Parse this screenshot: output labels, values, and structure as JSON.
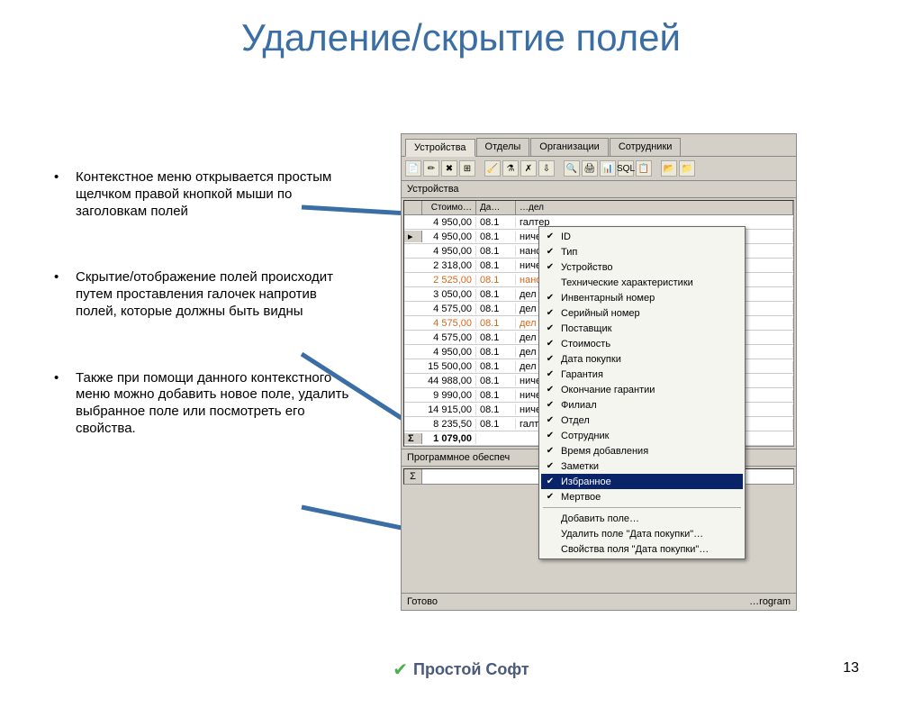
{
  "title": "Удаление/скрытие полей",
  "bullets": [
    "Контекстное меню открывается простым щелчком правой кнопкой мыши по заголовкам полей",
    "Скрытие/отображение полей происходит путем проставления галочек напротив полей, которые должны быть видны",
    "Также при помощи данного контекстного меню можно добавить новое поле, удалить выбранное поле или посмотреть его свойства."
  ],
  "page_number": "13",
  "footer_brand": "Простой Софт",
  "app": {
    "tabs": [
      "Устройства",
      "Отделы",
      "Организации",
      "Сотрудники"
    ],
    "active_tab": 0,
    "section1": "Устройства",
    "columns": [
      "Стоимо…",
      "Да…",
      "",
      "…дел"
    ],
    "rows": [
      {
        "c1": "4 950,00",
        "c2": "08.1",
        "c3": "галтер",
        "orange": false,
        "sel": false
      },
      {
        "c1": "4 950,00",
        "c2": "08.1",
        "c3": "ническ",
        "orange": false,
        "sel": true
      },
      {
        "c1": "4 950,00",
        "c2": "08.1",
        "c3": "нансов",
        "orange": false,
        "sel": false
      },
      {
        "c1": "2 318,00",
        "c2": "08.1",
        "c3": "ническ",
        "orange": false,
        "sel": false
      },
      {
        "c1": "2 525,00",
        "c2": "08.1",
        "c3": "нансов",
        "orange": true,
        "sel": false
      },
      {
        "c1": "3 050,00",
        "c2": "08.1",
        "c3": "дел раз",
        "orange": false,
        "sel": false
      },
      {
        "c1": "4 575,00",
        "c2": "08.1",
        "c3": "дел раз",
        "orange": false,
        "sel": false
      },
      {
        "c1": "4 575,00",
        "c2": "08.1",
        "c3": "дел раз",
        "orange": true,
        "sel": false
      },
      {
        "c1": "4 575,00",
        "c2": "08.1",
        "c3": "дел раз",
        "orange": false,
        "sel": false
      },
      {
        "c1": "4 950,00",
        "c2": "08.1",
        "c3": "дел раз",
        "orange": false,
        "sel": false
      },
      {
        "c1": "15 500,00",
        "c2": "08.1",
        "c3": "дел раз",
        "orange": false,
        "sel": false
      },
      {
        "c1": "44 988,00",
        "c2": "08.1",
        "c3": "ническ",
        "orange": false,
        "sel": false
      },
      {
        "c1": "9 990,00",
        "c2": "08.1",
        "c3": "ническ",
        "orange": false,
        "sel": false
      },
      {
        "c1": "14 915,00",
        "c2": "08.1",
        "c3": "ническ",
        "orange": false,
        "sel": false
      },
      {
        "c1": "8 235,50",
        "c2": "08.1",
        "c3": "галтер",
        "orange": false,
        "sel": false
      }
    ],
    "sum": "1 079,00",
    "section2": "Программное обеспеч",
    "status_left": "Готово",
    "status_right": "…rogram"
  },
  "context_menu": {
    "items": [
      {
        "label": "ID",
        "check": true
      },
      {
        "label": "Тип",
        "check": true
      },
      {
        "label": "Устройство",
        "check": true
      },
      {
        "label": "Технические характеристики",
        "check": false
      },
      {
        "label": "Инвентарный номер",
        "check": true
      },
      {
        "label": "Серийный номер",
        "check": true
      },
      {
        "label": "Поставщик",
        "check": true
      },
      {
        "label": "Стоимость",
        "check": true
      },
      {
        "label": "Дата покупки",
        "check": true
      },
      {
        "label": "Гарантия",
        "check": true
      },
      {
        "label": "Окончание гарантии",
        "check": true
      },
      {
        "label": "Филиал",
        "check": true
      },
      {
        "label": "Отдел",
        "check": true
      },
      {
        "label": "Сотрудник",
        "check": true
      },
      {
        "label": "Время добавления",
        "check": true
      },
      {
        "label": "Заметки",
        "check": true
      },
      {
        "label": "Избранное",
        "check": true,
        "selected": true
      },
      {
        "label": "Мертвое",
        "check": true
      }
    ],
    "actions": [
      "Добавить поле…",
      "Удалить поле \"Дата покупки\"…",
      "Свойства поля \"Дата покупки\"…"
    ]
  },
  "toolbar_icons": [
    "📄",
    "✏",
    "✖",
    "⊞",
    "🧹",
    "⚗",
    "✗",
    "⇩",
    "🔍",
    "🖨",
    "📊",
    "SQL",
    "📋",
    "📂",
    "📁"
  ]
}
